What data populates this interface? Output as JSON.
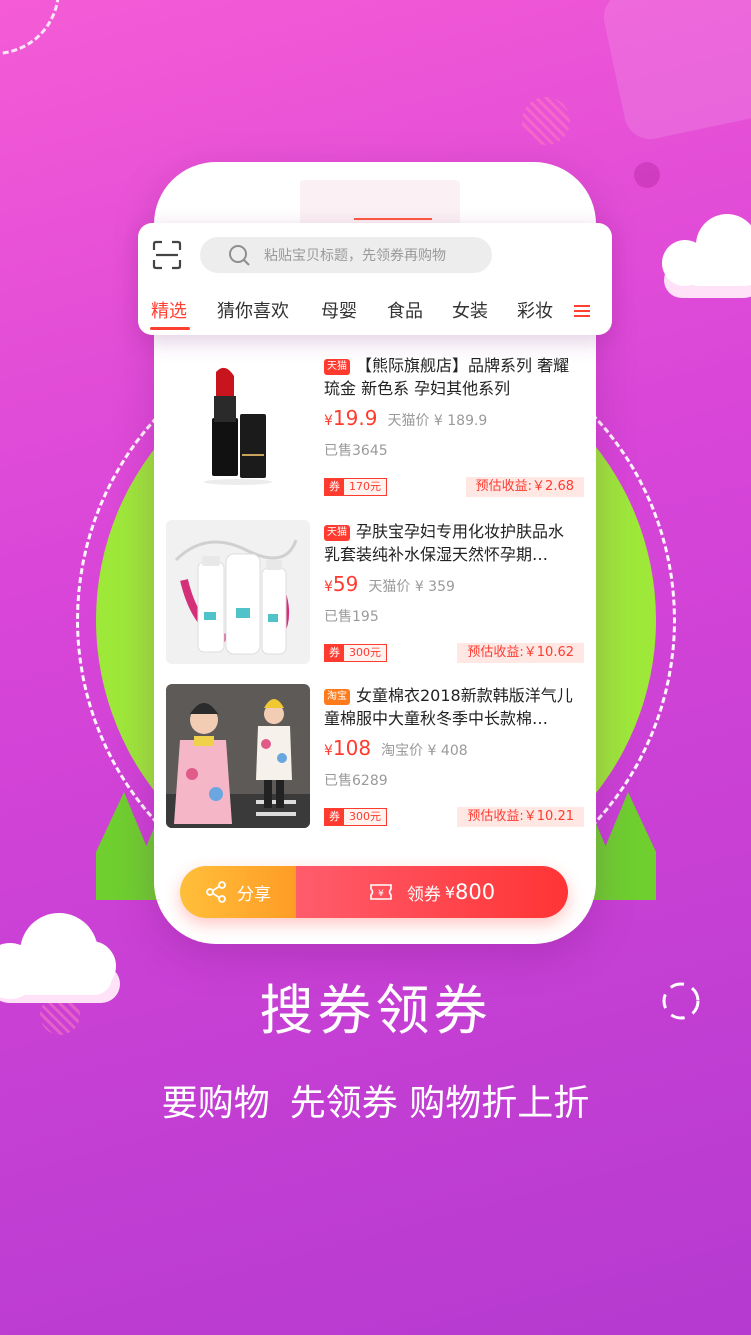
{
  "search": {
    "placeholder": "粘贴宝贝标题，先领券再购物"
  },
  "tabs": [
    {
      "label": "精选",
      "active": true
    },
    {
      "label": "猜你喜欢",
      "active": false
    },
    {
      "label": "母婴",
      "active": false
    },
    {
      "label": "食品",
      "active": false
    },
    {
      "label": "女装",
      "active": false
    },
    {
      "label": "彩妆",
      "active": false
    }
  ],
  "products": [
    {
      "badge": "天猫",
      "title": "【熊际旗舰店】品牌系列 奢耀琉金 新色系 孕妇其他系列",
      "yen": "¥",
      "price": "19.9",
      "orig": "天猫价 ¥ 189.9",
      "sold": "已售3645",
      "coupon_label": "券",
      "coupon_value": "170元",
      "earn": "预估收益:￥2.68"
    },
    {
      "badge": "天猫",
      "title": "孕肤宝孕妇专用化妆护肤品水乳套装纯补水保湿天然怀孕期…",
      "yen": "¥",
      "price": "59",
      "orig": "天猫价 ¥ 359",
      "sold": "已售195",
      "coupon_label": "券",
      "coupon_value": "300元",
      "earn": "预估收益:￥10.62"
    },
    {
      "badge": "淘宝",
      "title": "女童棉衣2018新款韩版洋气儿童棉服中大童秋冬季中长款棉…",
      "yen": "¥",
      "price": "108",
      "orig": "淘宝价 ¥ 408",
      "sold": "已售6289",
      "coupon_label": "券",
      "coupon_value": "300元",
      "earn": "预估收益:￥10.21"
    }
  ],
  "actions": {
    "share_label": "分享",
    "claim_label": "领券",
    "claim_yen": "¥",
    "claim_amount": "800"
  },
  "headline": "搜券领券",
  "subline": [
    "要购物",
    "先领券 购物折上折"
  ],
  "colors": {
    "accent": "#ff3b30",
    "bg_start": "#f45bd6",
    "bg_end": "#b53ad0",
    "green": "#9ee83a",
    "share": "#ffab2e"
  },
  "icons": [
    "scan-icon",
    "search-icon",
    "menu-icon",
    "share-icon",
    "coupon-icon",
    "loader-icon"
  ]
}
